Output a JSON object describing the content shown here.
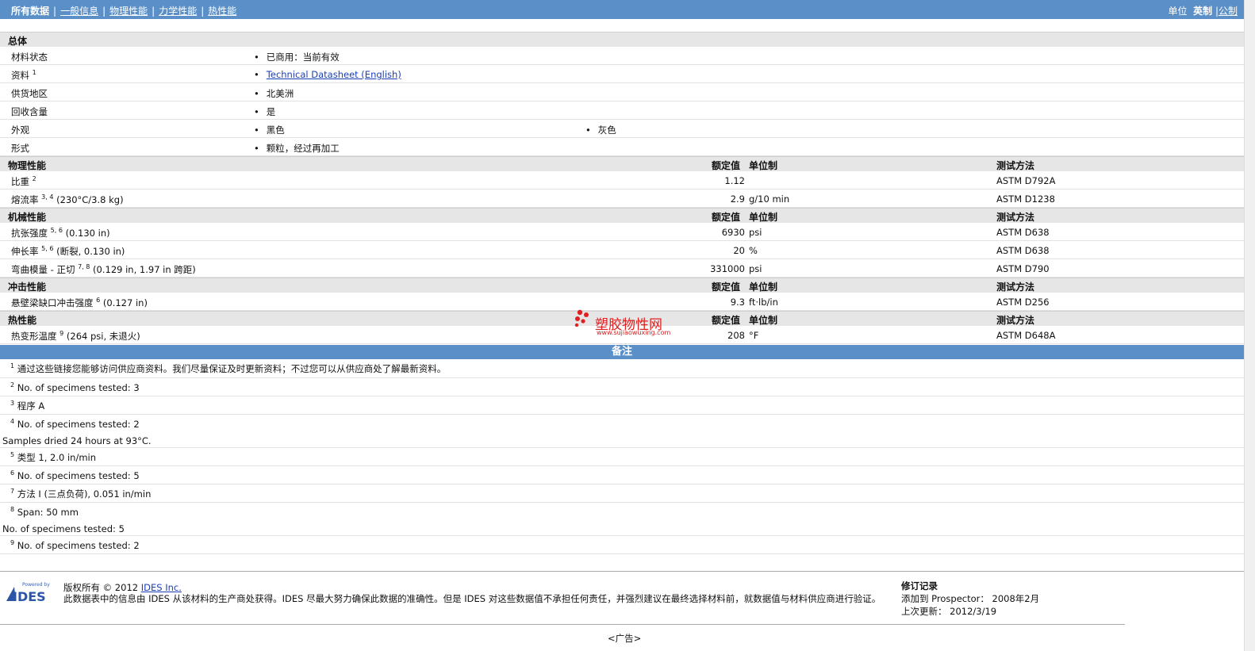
{
  "nav": {
    "items": [
      {
        "label": "所有数据"
      },
      {
        "label": "一般信息"
      },
      {
        "label": "物理性能"
      },
      {
        "label": "力学性能"
      },
      {
        "label": "热性能"
      }
    ],
    "unit_label": "单位",
    "unit_imperial": "英制",
    "unit_metric": "公制"
  },
  "general": {
    "title": "总体",
    "rows": [
      {
        "label": "材料状态",
        "sup": "",
        "values": [
          "已商用：当前有效"
        ]
      },
      {
        "label": "资料",
        "sup": "1",
        "values": [
          "Technical Datasheet (English)"
        ]
      },
      {
        "label": "供货地区",
        "sup": "",
        "values": [
          "北美洲"
        ]
      },
      {
        "label": "回收含量",
        "sup": "",
        "values": [
          "是"
        ]
      },
      {
        "label": "外观",
        "sup": "",
        "values": [
          "黑色",
          "灰色"
        ]
      },
      {
        "label": "形式",
        "sup": "",
        "values": [
          "颗粒，经过再加工"
        ]
      }
    ]
  },
  "headers": {
    "nominal": "额定值",
    "unit": "单位制",
    "method": "测试方法"
  },
  "sections": [
    {
      "title": "物理性能",
      "rows": [
        {
          "label": "比重",
          "sup": "2",
          "cond": "",
          "value": "1.12",
          "unit": "",
          "method": "ASTM D792A"
        },
        {
          "label": "熔流率",
          "sup": "3, 4",
          "cond": "(230°C/3.8 kg)",
          "value": "2.9",
          "unit": "g/10 min",
          "method": "ASTM D1238"
        }
      ]
    },
    {
      "title": "机械性能",
      "rows": [
        {
          "label": "抗张强度",
          "sup": "5, 6",
          "cond": "(0.130 in)",
          "value": "6930",
          "unit": "psi",
          "method": "ASTM D638"
        },
        {
          "label": "伸长率",
          "sup": "5, 6",
          "cond": "(断裂, 0.130 in)",
          "value": "20",
          "unit": "%",
          "method": "ASTM D638"
        },
        {
          "label": "弯曲模量 - 正切",
          "sup": "7, 8",
          "cond": "(0.129 in, 1.97 in 跨距)",
          "value": "331000",
          "unit": "psi",
          "method": "ASTM D790"
        }
      ]
    },
    {
      "title": "冲击性能",
      "rows": [
        {
          "label": "悬壁梁缺口冲击强度",
          "sup": "6",
          "cond": "(0.127 in)",
          "value": "9.3",
          "unit": "ft·lb/in",
          "method": "ASTM D256"
        }
      ]
    },
    {
      "title": "热性能",
      "rows": [
        {
          "label": "热变形温度",
          "sup": "9",
          "cond": "(264 psi, 未退火)",
          "value": "208",
          "unit": "°F",
          "method": "ASTM D648A"
        }
      ]
    }
  ],
  "watermark": {
    "text": "塑胶物性网",
    "url": "www.sujiaowuxing.com"
  },
  "notes": {
    "title": "备注",
    "items": [
      {
        "num": "1",
        "lines": [
          "通过这些链接您能够访问供应商资料。我们尽量保证及时更新资料；不过您可以从供应商处了解最新资料。"
        ]
      },
      {
        "num": "2",
        "lines": [
          "No. of specimens tested: 3"
        ]
      },
      {
        "num": "3",
        "lines": [
          "程序  A"
        ]
      },
      {
        "num": "4",
        "lines": [
          "No. of specimens tested: 2",
          "Samples dried 24 hours at 93°C."
        ]
      },
      {
        "num": "5",
        "lines": [
          "类型  1, 2.0 in/min"
        ]
      },
      {
        "num": "6",
        "lines": [
          "No. of specimens tested: 5"
        ]
      },
      {
        "num": "7",
        "lines": [
          "方法  I (三点负荷), 0.051 in/min"
        ]
      },
      {
        "num": "8",
        "lines": [
          "Span: 50 mm",
          "No. of specimens tested: 5"
        ]
      },
      {
        "num": "9",
        "lines": [
          "No. of specimens tested: 2"
        ]
      }
    ]
  },
  "footer": {
    "logo_small": "Powered by",
    "logo_text": "IDES",
    "copyright_prefix": "版权所有  © 2012",
    "copyright_link": "IDES Inc.",
    "disclaimer": "此数据表中的信息由  IDES 从该材料的生产商处获得。IDES 尽最大努力确保此数据的准确性。但是  IDES 对这些数据值不承担任何责任，并强烈建议在最终选择材料前，就数据值与材料供应商进行验证。",
    "revision_title": "修订记录",
    "added_label": "添加到  Prospector：",
    "added_value": "2008年2月",
    "updated_label": "上次更新：",
    "updated_value": "2012/3/19",
    "ad": "<广告>"
  }
}
